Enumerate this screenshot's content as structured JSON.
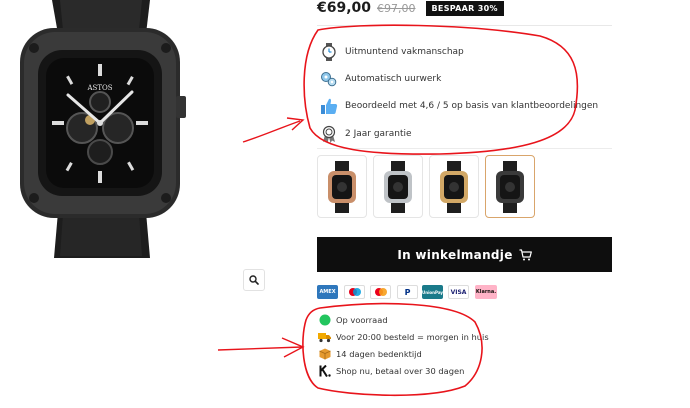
{
  "product": {
    "price_current": "€69,00",
    "price_old": "€97,00",
    "discount_badge": "BESPAAR 30%",
    "brand_on_dial": "ASTOS"
  },
  "features": [
    {
      "icon": "watch-icon",
      "text": "Uitmuntend vakmanschap"
    },
    {
      "icon": "gears-icon",
      "text": "Automatisch uurwerk"
    },
    {
      "icon": "thumbs-up-icon",
      "text": "Beoordeeld met 4,6 / 5 op basis van klantbeoordelingen"
    },
    {
      "icon": "award-ribbon-icon",
      "text": "2 Jaar garantie"
    }
  ],
  "variants": [
    {
      "name": "rose-gold-black",
      "selected": false
    },
    {
      "name": "silver-black",
      "selected": false
    },
    {
      "name": "gold-black",
      "selected": false
    },
    {
      "name": "all-black",
      "selected": true
    }
  ],
  "cart": {
    "label": "In winkelmandje",
    "icon": "cart-icon"
  },
  "payments": [
    {
      "name": "American Express",
      "label": "AMEX",
      "bg": "#2e77bc",
      "fg": "#ffffff"
    },
    {
      "name": "Maestro",
      "label": "",
      "bg": "#ffffff",
      "fg": "#000000"
    },
    {
      "name": "Mastercard",
      "label": "",
      "bg": "#ffffff",
      "fg": "#000000"
    },
    {
      "name": "PayPal",
      "label": "P",
      "bg": "#ffffff",
      "fg": "#003087"
    },
    {
      "name": "Union Pay",
      "label": "UnionPay",
      "bg": "#1a7a8a",
      "fg": "#ffffff"
    },
    {
      "name": "Visa",
      "label": "VISA",
      "bg": "#ffffff",
      "fg": "#1a1f71"
    },
    {
      "name": "Klarna",
      "label": "Klarna.",
      "bg": "#ffb3c7",
      "fg": "#17120f"
    }
  ],
  "info": [
    {
      "icon": "in-stock-dot-icon",
      "text": "Op voorraad"
    },
    {
      "icon": "delivery-truck-icon",
      "text": "Voor 20:00 besteld = morgen in huis"
    },
    {
      "icon": "package-box-icon",
      "text": "14 dagen bedenktijd"
    },
    {
      "icon": "klarna-k-icon",
      "text": "Shop nu, betaal over 30 dagen"
    }
  ],
  "colors": {
    "accent_dark": "#0e0e0e",
    "annotation_red": "#e8141b",
    "stock_green": "#22c55e",
    "selected_border": "#d9a56b"
  }
}
